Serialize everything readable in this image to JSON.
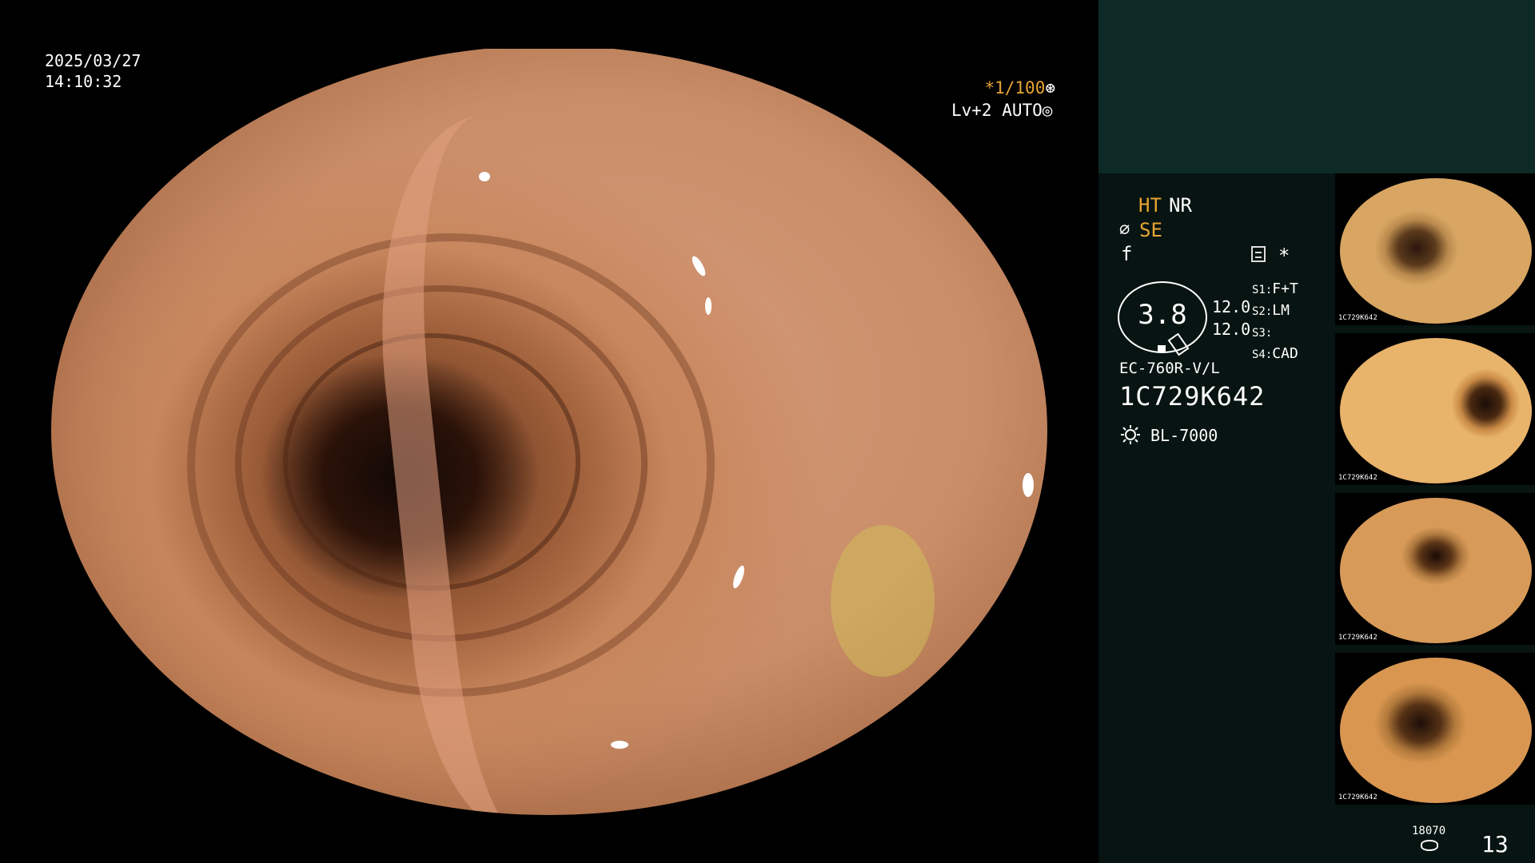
{
  "overlay": {
    "date": "2025/03/27",
    "time": "14:10:32",
    "exposure": "*1/100",
    "exposure_icon": "aperture-icon",
    "level": "Lv+2 AUTO",
    "level_icon": "auto-iris-icon"
  },
  "status": {
    "ht": "HT",
    "nr": "NR",
    "se_icon": "⌀",
    "se": "SE",
    "f_icon": "f",
    "settings_icon": "settings-icon",
    "star": "*"
  },
  "gauge": {
    "value": "3.8",
    "value_a": "12.0",
    "value_b": "12.0"
  },
  "slots": [
    {
      "key": "S1:",
      "value": "F+T"
    },
    {
      "key": "S2:",
      "value": "LM"
    },
    {
      "key": "S3:",
      "value": ""
    },
    {
      "key": "S4:",
      "value": "CAD"
    }
  ],
  "device": {
    "model": "EC-760R-V/L",
    "serial": "1C729K642",
    "lamp": "BL-7000",
    "lamp_icon": "light-source-icon"
  },
  "thumbnails": [
    {
      "label": "1C729K642"
    },
    {
      "label": "1C729K642"
    },
    {
      "label": "1C729K642"
    },
    {
      "label": "1C729K642"
    }
  ],
  "footer": {
    "capacity": "18070",
    "storage_icon": "storage-icon",
    "image_count": "13"
  },
  "colors": {
    "accent": "#e8a534",
    "panel_top": "#0d2a27",
    "panel_side": "#071411"
  }
}
